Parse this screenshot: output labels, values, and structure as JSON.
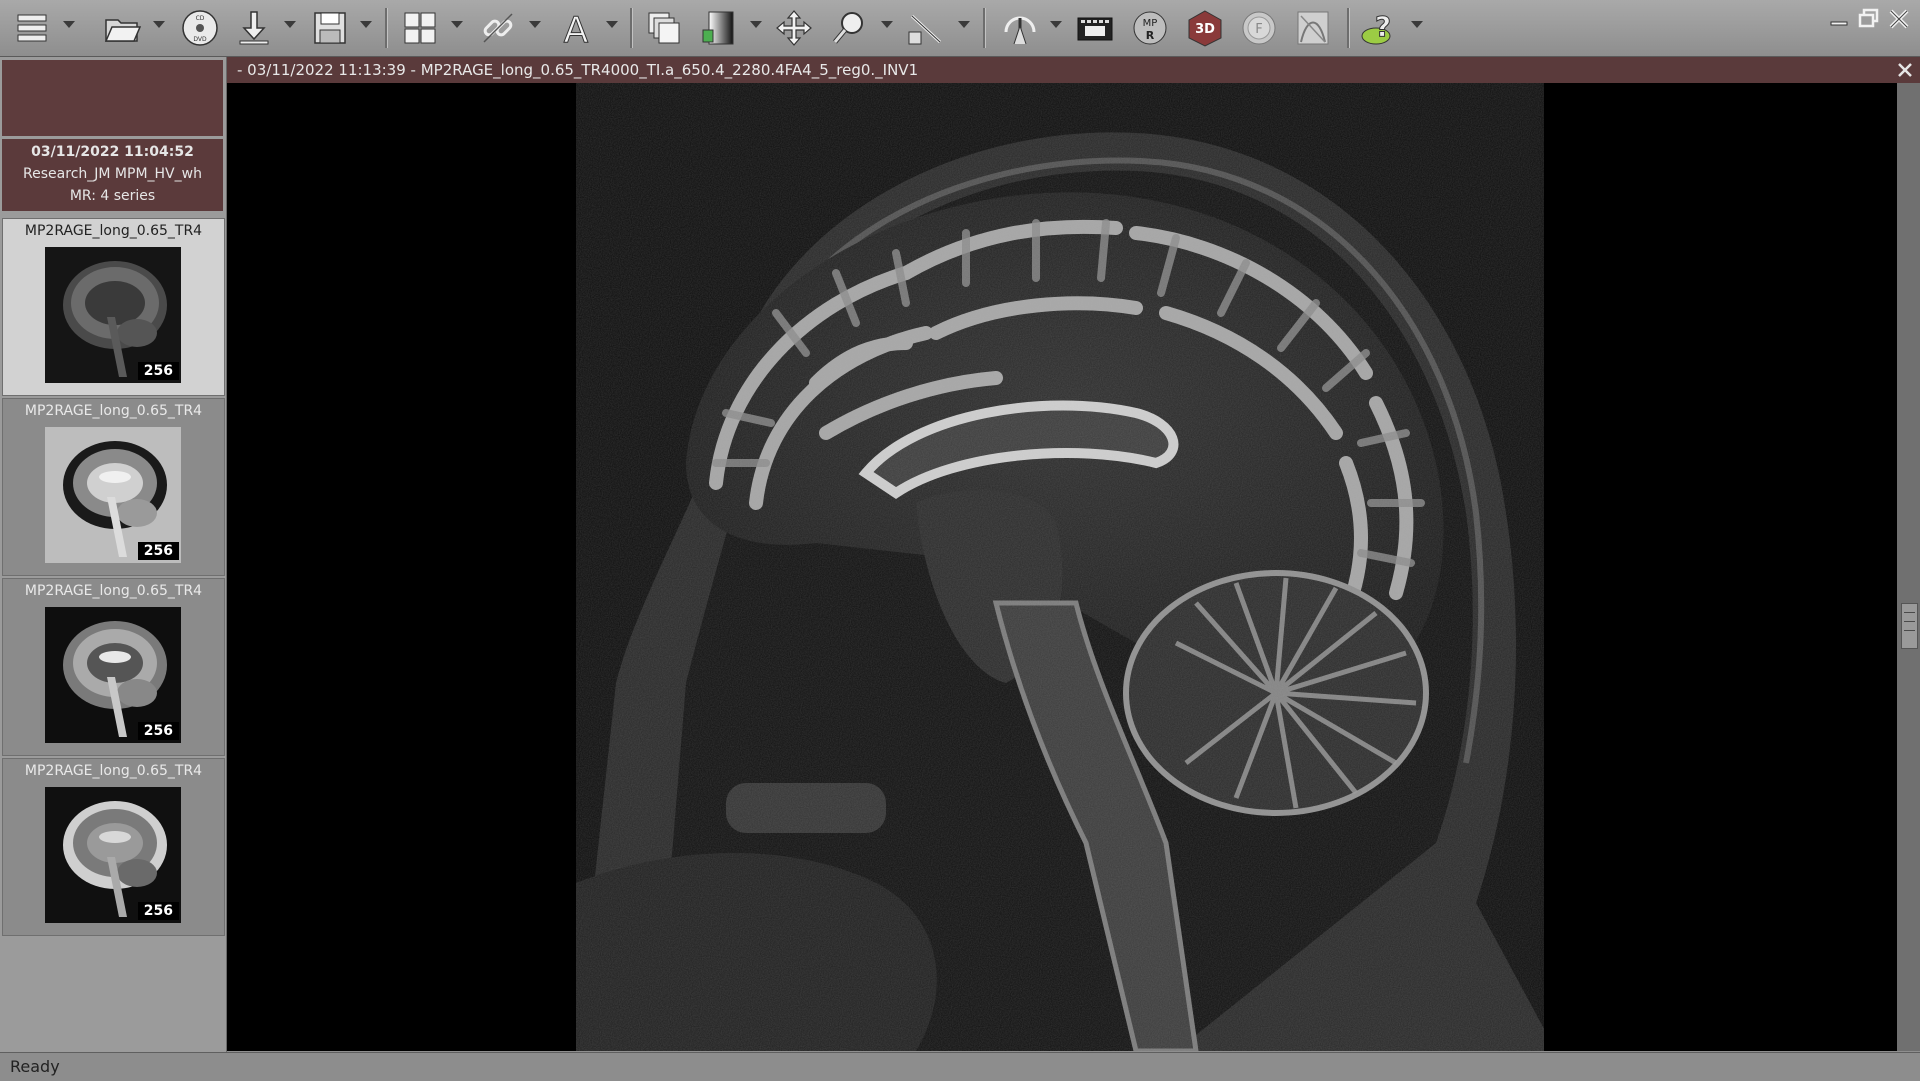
{
  "toolbar": {
    "tools": [
      {
        "name": "menu-icon"
      },
      {
        "name": "open-folder-icon"
      },
      {
        "name": "cd-dvd-icon",
        "label": "CD DVD"
      },
      {
        "name": "download-icon"
      },
      {
        "name": "save-icon"
      },
      {
        "name": "layout-grid-icon"
      },
      {
        "name": "link-icon"
      },
      {
        "name": "text-annotation-icon",
        "label": "A"
      },
      {
        "name": "series-stack-icon"
      },
      {
        "name": "window-level-icon"
      },
      {
        "name": "pan-icon"
      },
      {
        "name": "zoom-icon"
      },
      {
        "name": "measure-icon"
      },
      {
        "name": "reference-lines-icon"
      },
      {
        "name": "cine-icon"
      },
      {
        "name": "mpr-icon",
        "label": "MPR"
      },
      {
        "name": "3d-icon",
        "label": "3D"
      },
      {
        "name": "fusion-icon",
        "label": "F"
      },
      {
        "name": "curve-icon"
      },
      {
        "name": "help-icon"
      }
    ]
  },
  "study": {
    "date": "03/11/2022 11:04:52",
    "name": "Research_JM MPM_HV_wh",
    "summary": "MR: 4 series"
  },
  "series": [
    {
      "label": "MP2RAGE_long_0.65_TR4",
      "count": "256",
      "selected": true
    },
    {
      "label": "MP2RAGE_long_0.65_TR4",
      "count": "256",
      "selected": false
    },
    {
      "label": "MP2RAGE_long_0.65_TR4",
      "count": "256",
      "selected": false
    },
    {
      "label": "MP2RAGE_long_0.65_TR4",
      "count": "256",
      "selected": false
    }
  ],
  "viewer": {
    "title": "- 03/11/2022 11:13:39 - MP2RAGE_long_0.65_TR4000_TI.a_650.4_2280.4FA4_5_reg0._INV1"
  },
  "status": {
    "text": "Ready"
  },
  "colors": {
    "accent_maroon": "#5a3a3b",
    "toolbar_gray": "#9c9c9c",
    "viewer_black": "#000000"
  }
}
